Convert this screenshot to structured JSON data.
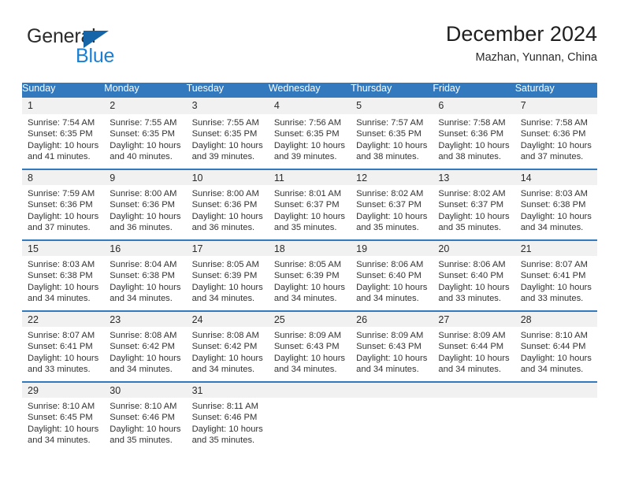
{
  "brand": {
    "name_top": "General",
    "name_bottom": "Blue",
    "triangle_color": "#1565a8",
    "blue_text_color": "#1a7fd4"
  },
  "header": {
    "title": "December 2024",
    "subtitle": "Mazhan, Yunnan, China"
  },
  "theme": {
    "header_blue": "#3279bd",
    "daynum_band": "#f1f1f1",
    "text": "#333333"
  },
  "calendar": {
    "weekday_headers": [
      "Sunday",
      "Monday",
      "Tuesday",
      "Wednesday",
      "Thursday",
      "Friday",
      "Saturday"
    ],
    "weeks": [
      [
        {
          "day": "1",
          "sunrise": "Sunrise: 7:54 AM",
          "sunset": "Sunset: 6:35 PM",
          "daylight_1": "Daylight: 10 hours",
          "daylight_2": "and 41 minutes."
        },
        {
          "day": "2",
          "sunrise": "Sunrise: 7:55 AM",
          "sunset": "Sunset: 6:35 PM",
          "daylight_1": "Daylight: 10 hours",
          "daylight_2": "and 40 minutes."
        },
        {
          "day": "3",
          "sunrise": "Sunrise: 7:55 AM",
          "sunset": "Sunset: 6:35 PM",
          "daylight_1": "Daylight: 10 hours",
          "daylight_2": "and 39 minutes."
        },
        {
          "day": "4",
          "sunrise": "Sunrise: 7:56 AM",
          "sunset": "Sunset: 6:35 PM",
          "daylight_1": "Daylight: 10 hours",
          "daylight_2": "and 39 minutes."
        },
        {
          "day": "5",
          "sunrise": "Sunrise: 7:57 AM",
          "sunset": "Sunset: 6:35 PM",
          "daylight_1": "Daylight: 10 hours",
          "daylight_2": "and 38 minutes."
        },
        {
          "day": "6",
          "sunrise": "Sunrise: 7:58 AM",
          "sunset": "Sunset: 6:36 PM",
          "daylight_1": "Daylight: 10 hours",
          "daylight_2": "and 38 minutes."
        },
        {
          "day": "7",
          "sunrise": "Sunrise: 7:58 AM",
          "sunset": "Sunset: 6:36 PM",
          "daylight_1": "Daylight: 10 hours",
          "daylight_2": "and 37 minutes."
        }
      ],
      [
        {
          "day": "8",
          "sunrise": "Sunrise: 7:59 AM",
          "sunset": "Sunset: 6:36 PM",
          "daylight_1": "Daylight: 10 hours",
          "daylight_2": "and 37 minutes."
        },
        {
          "day": "9",
          "sunrise": "Sunrise: 8:00 AM",
          "sunset": "Sunset: 6:36 PM",
          "daylight_1": "Daylight: 10 hours",
          "daylight_2": "and 36 minutes."
        },
        {
          "day": "10",
          "sunrise": "Sunrise: 8:00 AM",
          "sunset": "Sunset: 6:36 PM",
          "daylight_1": "Daylight: 10 hours",
          "daylight_2": "and 36 minutes."
        },
        {
          "day": "11",
          "sunrise": "Sunrise: 8:01 AM",
          "sunset": "Sunset: 6:37 PM",
          "daylight_1": "Daylight: 10 hours",
          "daylight_2": "and 35 minutes."
        },
        {
          "day": "12",
          "sunrise": "Sunrise: 8:02 AM",
          "sunset": "Sunset: 6:37 PM",
          "daylight_1": "Daylight: 10 hours",
          "daylight_2": "and 35 minutes."
        },
        {
          "day": "13",
          "sunrise": "Sunrise: 8:02 AM",
          "sunset": "Sunset: 6:37 PM",
          "daylight_1": "Daylight: 10 hours",
          "daylight_2": "and 35 minutes."
        },
        {
          "day": "14",
          "sunrise": "Sunrise: 8:03 AM",
          "sunset": "Sunset: 6:38 PM",
          "daylight_1": "Daylight: 10 hours",
          "daylight_2": "and 34 minutes."
        }
      ],
      [
        {
          "day": "15",
          "sunrise": "Sunrise: 8:03 AM",
          "sunset": "Sunset: 6:38 PM",
          "daylight_1": "Daylight: 10 hours",
          "daylight_2": "and 34 minutes."
        },
        {
          "day": "16",
          "sunrise": "Sunrise: 8:04 AM",
          "sunset": "Sunset: 6:38 PM",
          "daylight_1": "Daylight: 10 hours",
          "daylight_2": "and 34 minutes."
        },
        {
          "day": "17",
          "sunrise": "Sunrise: 8:05 AM",
          "sunset": "Sunset: 6:39 PM",
          "daylight_1": "Daylight: 10 hours",
          "daylight_2": "and 34 minutes."
        },
        {
          "day": "18",
          "sunrise": "Sunrise: 8:05 AM",
          "sunset": "Sunset: 6:39 PM",
          "daylight_1": "Daylight: 10 hours",
          "daylight_2": "and 34 minutes."
        },
        {
          "day": "19",
          "sunrise": "Sunrise: 8:06 AM",
          "sunset": "Sunset: 6:40 PM",
          "daylight_1": "Daylight: 10 hours",
          "daylight_2": "and 34 minutes."
        },
        {
          "day": "20",
          "sunrise": "Sunrise: 8:06 AM",
          "sunset": "Sunset: 6:40 PM",
          "daylight_1": "Daylight: 10 hours",
          "daylight_2": "and 33 minutes."
        },
        {
          "day": "21",
          "sunrise": "Sunrise: 8:07 AM",
          "sunset": "Sunset: 6:41 PM",
          "daylight_1": "Daylight: 10 hours",
          "daylight_2": "and 33 minutes."
        }
      ],
      [
        {
          "day": "22",
          "sunrise": "Sunrise: 8:07 AM",
          "sunset": "Sunset: 6:41 PM",
          "daylight_1": "Daylight: 10 hours",
          "daylight_2": "and 33 minutes."
        },
        {
          "day": "23",
          "sunrise": "Sunrise: 8:08 AM",
          "sunset": "Sunset: 6:42 PM",
          "daylight_1": "Daylight: 10 hours",
          "daylight_2": "and 34 minutes."
        },
        {
          "day": "24",
          "sunrise": "Sunrise: 8:08 AM",
          "sunset": "Sunset: 6:42 PM",
          "daylight_1": "Daylight: 10 hours",
          "daylight_2": "and 34 minutes."
        },
        {
          "day": "25",
          "sunrise": "Sunrise: 8:09 AM",
          "sunset": "Sunset: 6:43 PM",
          "daylight_1": "Daylight: 10 hours",
          "daylight_2": "and 34 minutes."
        },
        {
          "day": "26",
          "sunrise": "Sunrise: 8:09 AM",
          "sunset": "Sunset: 6:43 PM",
          "daylight_1": "Daylight: 10 hours",
          "daylight_2": "and 34 minutes."
        },
        {
          "day": "27",
          "sunrise": "Sunrise: 8:09 AM",
          "sunset": "Sunset: 6:44 PM",
          "daylight_1": "Daylight: 10 hours",
          "daylight_2": "and 34 minutes."
        },
        {
          "day": "28",
          "sunrise": "Sunrise: 8:10 AM",
          "sunset": "Sunset: 6:44 PM",
          "daylight_1": "Daylight: 10 hours",
          "daylight_2": "and 34 minutes."
        }
      ],
      [
        {
          "day": "29",
          "sunrise": "Sunrise: 8:10 AM",
          "sunset": "Sunset: 6:45 PM",
          "daylight_1": "Daylight: 10 hours",
          "daylight_2": "and 34 minutes."
        },
        {
          "day": "30",
          "sunrise": "Sunrise: 8:10 AM",
          "sunset": "Sunset: 6:46 PM",
          "daylight_1": "Daylight: 10 hours",
          "daylight_2": "and 35 minutes."
        },
        {
          "day": "31",
          "sunrise": "Sunrise: 8:11 AM",
          "sunset": "Sunset: 6:46 PM",
          "daylight_1": "Daylight: 10 hours",
          "daylight_2": "and 35 minutes."
        },
        {
          "day": "",
          "sunrise": "",
          "sunset": "",
          "daylight_1": "",
          "daylight_2": ""
        },
        {
          "day": "",
          "sunrise": "",
          "sunset": "",
          "daylight_1": "",
          "daylight_2": ""
        },
        {
          "day": "",
          "sunrise": "",
          "sunset": "",
          "daylight_1": "",
          "daylight_2": ""
        },
        {
          "day": "",
          "sunrise": "",
          "sunset": "",
          "daylight_1": "",
          "daylight_2": ""
        }
      ]
    ]
  }
}
